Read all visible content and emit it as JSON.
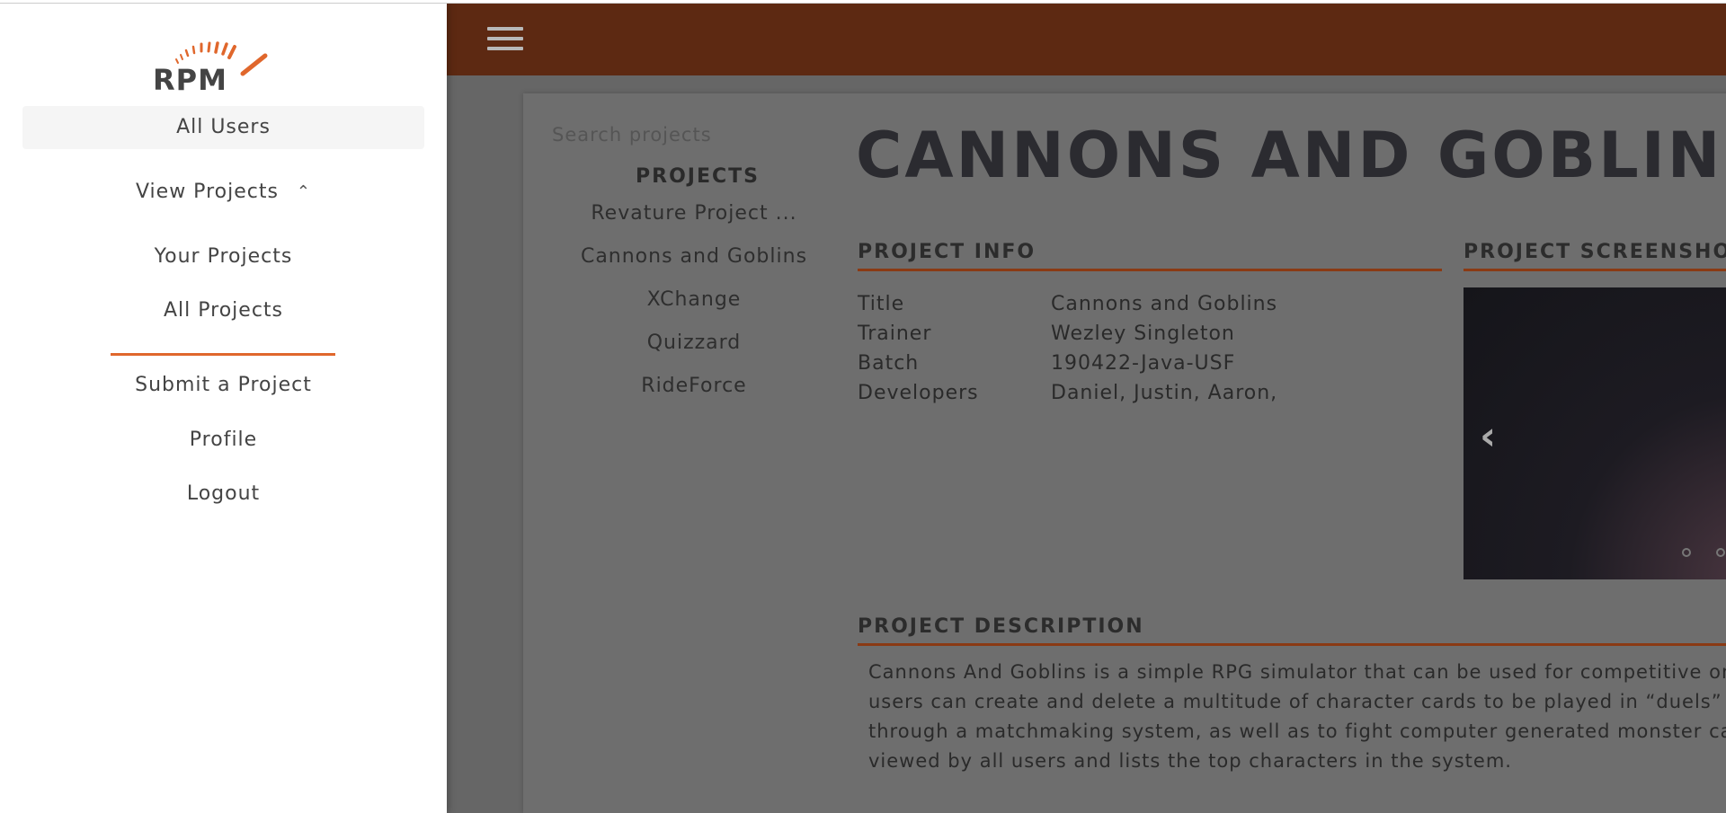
{
  "drawer": {
    "logo_text": "RPM",
    "items": {
      "all_users": "All Users",
      "view_projects": "View Projects",
      "your_projects": "Your Projects",
      "all_projects": "All Projects",
      "submit_project": "Submit a Project",
      "profile": "Profile",
      "logout": "Logout"
    },
    "chevron": "⌃"
  },
  "header": {
    "menu_icon": "hamburger-icon"
  },
  "sidebar": {
    "search_placeholder": "Search projects",
    "heading": "PROJECTS",
    "projects": [
      "Revature Project ...",
      "Cannons and Goblins",
      "XChange",
      "Quizzard",
      "RideForce"
    ]
  },
  "project": {
    "title": "CANNONS AND GOBLINS",
    "info_heading": "PROJECT INFO",
    "screenshots_heading": "PROJECT SCREENSHOTS",
    "info": [
      {
        "key": "Title",
        "value": "Cannons and Goblins"
      },
      {
        "key": "Trainer",
        "value": "Wezley Singleton"
      },
      {
        "key": "Batch",
        "value": "190422-Java-USF"
      },
      {
        "key": "Developers",
        "value": "Daniel, Justin, Aaron,"
      }
    ],
    "description_heading": "PROJECT DESCRIPTION",
    "description_lines": [
      "Cannons And Goblins is a simple RPG simulator that can be used for competitive onlin",
      "users can create and delete a multitude of character cards to be played in “duels” aga",
      "through a matchmaking system, as well as to fight computer generated monster cards.",
      "viewed by all users and lists the top characters in the system."
    ],
    "carousel_prev": "‹"
  },
  "colors": {
    "accent": "#e0672c",
    "header": "#5d2912",
    "section_rule": "#8a3a14"
  }
}
